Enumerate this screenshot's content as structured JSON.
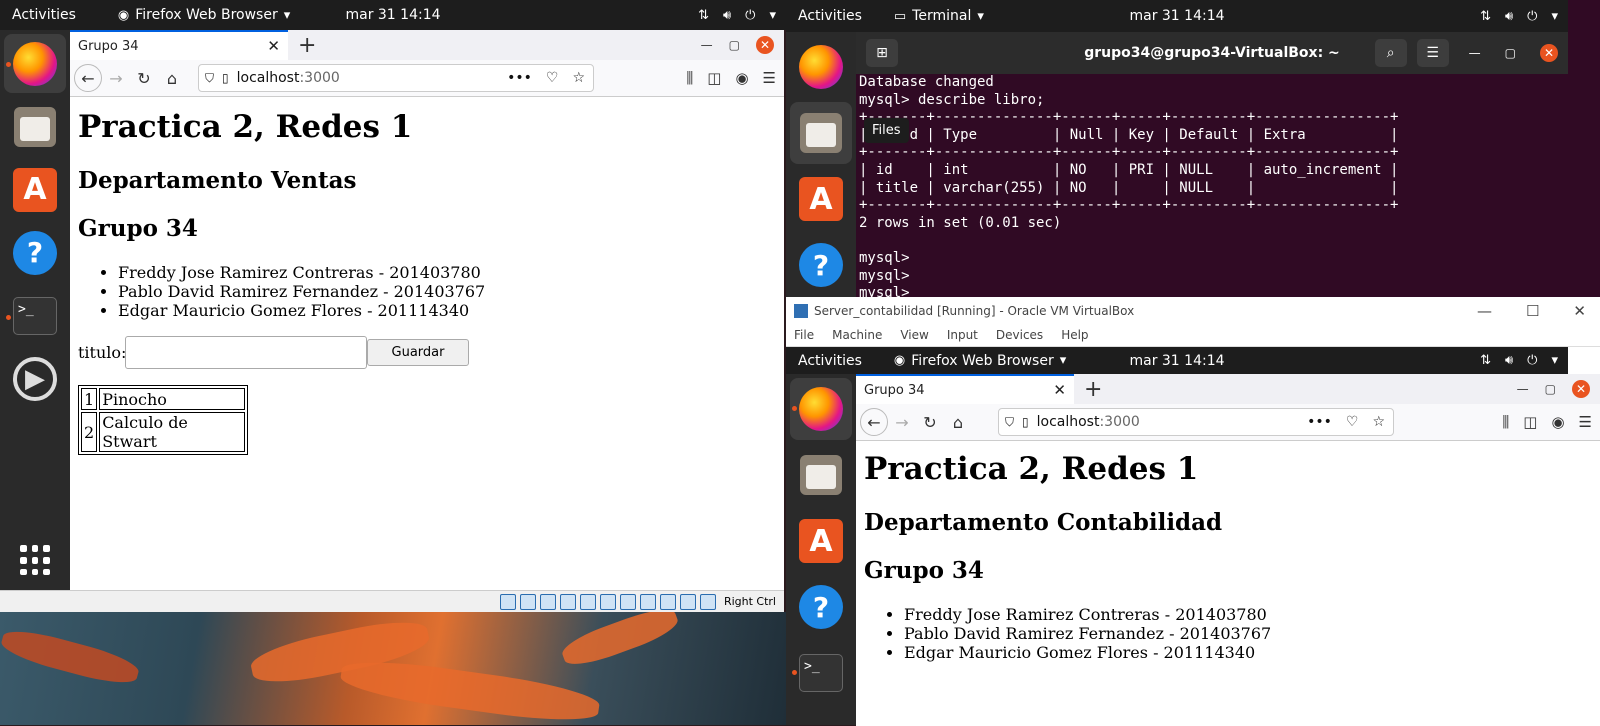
{
  "left_vm": {
    "topbar": {
      "activities": "Activities",
      "app_name": "Firefox Web Browser",
      "clock": "mar 31  14:14"
    },
    "status_bar": {
      "host_key": "Right Ctrl"
    },
    "browser": {
      "tab_title": "Grupo 34",
      "url_host": "localhost",
      "url_port": ":3000",
      "page": {
        "title": "Practica 2, Redes 1",
        "department": "Departamento Ventas",
        "group": "Grupo 34",
        "members": [
          "Freddy Jose Ramirez Contreras - 201403780",
          "Pablo David Ramirez Fernandez - 201403767",
          "Edgar Mauricio Gomez Flores - 201114340"
        ],
        "form_label": "titulo:",
        "form_button": "Guardar",
        "books": [
          {
            "id": "1",
            "title": "Pinocho"
          },
          {
            "id": "2",
            "title": "Calculo de Stwart"
          }
        ]
      }
    }
  },
  "right_top": {
    "topbar": {
      "activities": "Activities",
      "app_name": "Terminal",
      "clock": "mar 31  14:14"
    },
    "terminal": {
      "title": "grupo34@grupo34-VirtualBox: ~",
      "lines": [
        "Database changed",
        "mysql> describe libro;",
        "+-------+--------------+------+-----+---------+----------------+",
        "| Field | Type         | Null | Key | Default | Extra          |",
        "+-------+--------------+------+-----+---------+----------------+",
        "| id    | int          | NO   | PRI | NULL    | auto_increment |",
        "| title | varchar(255) | NO   |     | NULL    |                |",
        "+-------+--------------+------+-----+---------+----------------+",
        "2 rows in set (0.01 sec)",
        "",
        "mysql>",
        "mysql>",
        "mysql>"
      ],
      "tooltip": "Files"
    }
  },
  "right_vm": {
    "window_title": "Server_contabilidad [Running] - Oracle VM VirtualBox",
    "menu": [
      "File",
      "Machine",
      "View",
      "Input",
      "Devices",
      "Help"
    ],
    "topbar": {
      "activities": "Activities",
      "app_name": "Firefox Web Browser",
      "clock": "mar 31  14:14"
    },
    "browser": {
      "tab_title": "Grupo 34",
      "url_host": "localhost",
      "url_port": ":3000",
      "page": {
        "title": "Practica 2, Redes 1",
        "department": "Departamento Contabilidad",
        "group": "Grupo 34",
        "members": [
          "Freddy Jose Ramirez Contreras - 201403780",
          "Pablo David Ramirez Fernandez - 201403767",
          "Edgar Mauricio Gomez Flores - 201114340"
        ]
      }
    }
  },
  "colors": {
    "ubuntu_orange": "#e95420",
    "terminal_bg": "#300a24",
    "topbar_bg": "#1d1d1d",
    "dock_bg": "#2a2a2a"
  }
}
